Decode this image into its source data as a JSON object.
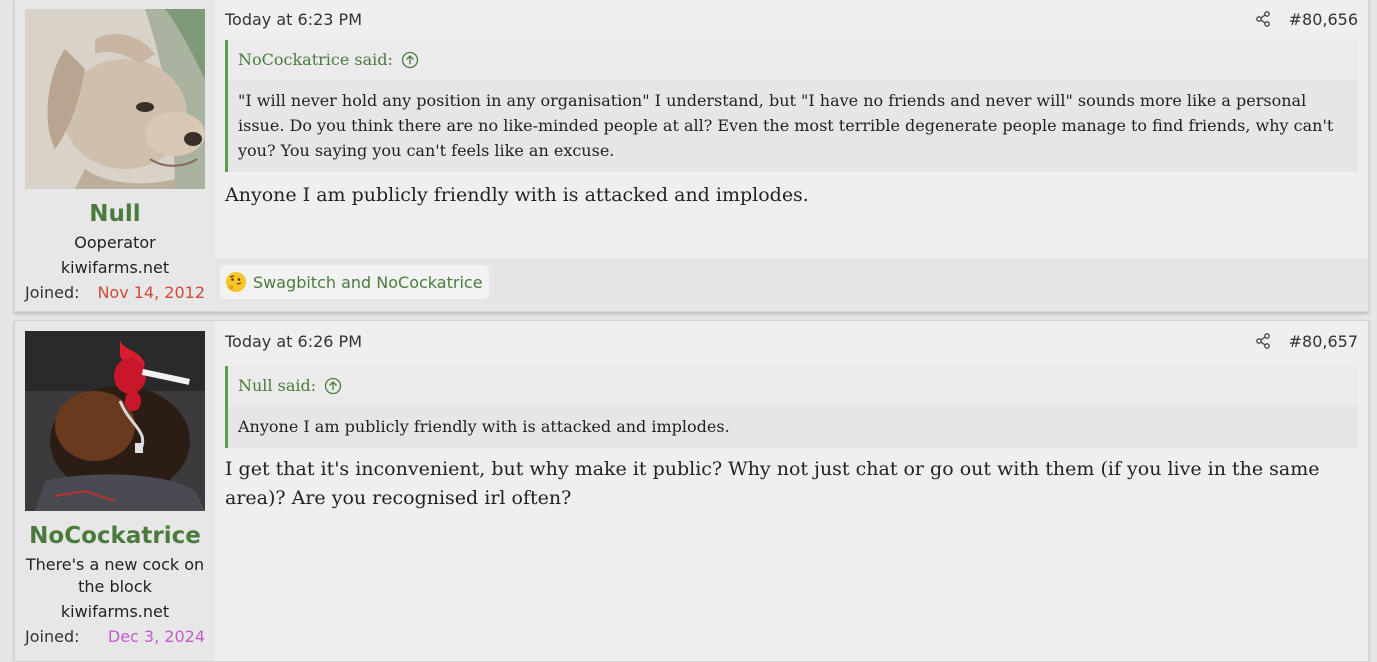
{
  "posts": [
    {
      "user": {
        "name": "Null",
        "title": "Ooperator",
        "banner": "kiwifarms.net",
        "joined_label": "Joined:",
        "joined_date": "Nov 14, 2012",
        "avatar_icon": "dog-avatar"
      },
      "timestamp": "Today at 6:23 PM",
      "post_number": "#80,656",
      "quote": {
        "author_line": "NoCockatrice said:",
        "text": "\"I will never hold any position in any organisation\" I understand, but \"I have no friends and never will\" sounds more like a personal issue. Do you think there are no like-minded people at all? Even the most terrible degenerate people manage to find friends, why can't you? You saying you can't feels like an excuse."
      },
      "message": "Anyone I am publicly friendly with is attacked and implodes.",
      "reactions": {
        "icon": "thinking-emoji",
        "text": "Swagbitch and NoCockatrice"
      }
    },
    {
      "user": {
        "name": "NoCockatrice",
        "title": "There's a new cock on the block",
        "banner": "kiwifarms.net",
        "joined_label": "Joined:",
        "joined_date": "Dec 3, 2024",
        "avatar_icon": "rooster-avatar"
      },
      "timestamp": "Today at 6:26 PM",
      "post_number": "#80,657",
      "quote": {
        "author_line": "Null said:",
        "text": "Anyone I am publicly friendly with is attacked and implodes."
      },
      "message": "I get that it's inconvenient, but why make it public? Why not just chat or go out with them (if you live in the same area)? Are you recognised irl often?"
    }
  ],
  "colors": {
    "accent_green": "#4a7a3c",
    "quote_border": "#5b9f4c",
    "joined_red": "#d04a3a",
    "joined_purple": "#c25ccc"
  }
}
